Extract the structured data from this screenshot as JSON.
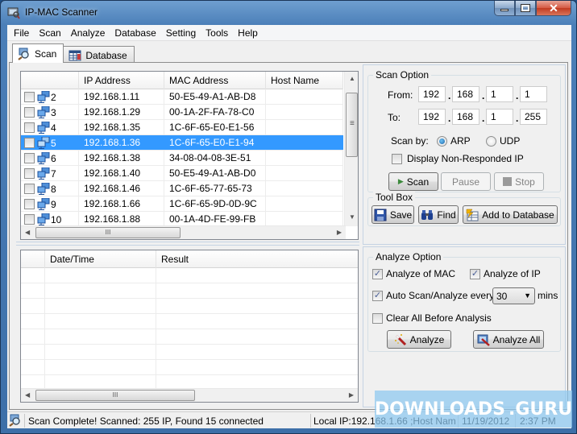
{
  "window": {
    "title": "IP-MAC Scanner",
    "buttons": {
      "minimize": "minimize",
      "maximize": "maximize",
      "close": "✕"
    }
  },
  "menu": [
    "File",
    "Scan",
    "Analyze",
    "Database",
    "Setting",
    "Tools",
    "Help"
  ],
  "tabs": [
    {
      "label": "Scan",
      "icon": "scan-icon",
      "active": true
    },
    {
      "label": "Database",
      "icon": "database-icon",
      "active": false
    }
  ],
  "scan_grid": {
    "columns": [
      "",
      "IP Address",
      "MAC Address",
      "Host Name"
    ],
    "rows": [
      {
        "num": "2",
        "ip": "192.168.1.11",
        "mac": "50-E5-49-A1-AB-D8",
        "host": "",
        "checked": false,
        "selected": false
      },
      {
        "num": "3",
        "ip": "192.168.1.29",
        "mac": "00-1A-2F-FA-78-C0",
        "host": "",
        "checked": false,
        "selected": false
      },
      {
        "num": "4",
        "ip": "192.168.1.35",
        "mac": "1C-6F-65-E0-E1-56",
        "host": "",
        "checked": false,
        "selected": false
      },
      {
        "num": "5",
        "ip": "192.168.1.36",
        "mac": "1C-6F-65-E0-E1-94",
        "host": "",
        "checked": false,
        "selected": true
      },
      {
        "num": "6",
        "ip": "192.168.1.38",
        "mac": "34-08-04-08-3E-51",
        "host": "",
        "checked": false,
        "selected": false
      },
      {
        "num": "7",
        "ip": "192.168.1.40",
        "mac": "50-E5-49-A1-AB-D0",
        "host": "",
        "checked": false,
        "selected": false
      },
      {
        "num": "8",
        "ip": "192.168.1.46",
        "mac": "1C-6F-65-77-65-73",
        "host": "",
        "checked": false,
        "selected": false
      },
      {
        "num": "9",
        "ip": "192.168.1.66",
        "mac": "1C-6F-65-9D-0D-9C",
        "host": "",
        "checked": false,
        "selected": false
      },
      {
        "num": "10",
        "ip": "192.168.1.88",
        "mac": "00-1A-4D-FE-99-FB",
        "host": "",
        "checked": false,
        "selected": false
      }
    ]
  },
  "result_grid": {
    "columns": [
      "",
      "Date/Time",
      "Result"
    ],
    "rows": []
  },
  "scan_option": {
    "title": "Scan Option",
    "from_label": "From:",
    "to_label": "To:",
    "from": [
      "192",
      "168",
      "1",
      "1"
    ],
    "to": [
      "192",
      "168",
      "1",
      "255"
    ],
    "scan_by_label": "Scan by:",
    "arp_label": "ARP",
    "udp_label": "UDP",
    "scan_by_selected": "ARP",
    "non_responded_label": "Display Non-Responded IP",
    "non_responded_checked": false,
    "scan_button": "Scan",
    "pause_button": "Pause",
    "stop_button": "Stop"
  },
  "tool_box": {
    "title": "Tool Box",
    "save_button": "Save",
    "find_button": "Find",
    "add_db_button": "Add to Database"
  },
  "analyze_option": {
    "title": "Analyze Option",
    "mac_label": "Analyze of MAC",
    "mac_checked": true,
    "ip_label": "Analyze of IP",
    "ip_checked": true,
    "auto_label": "Auto Scan/Analyze every",
    "auto_checked": true,
    "interval": "30",
    "interval_unit": "mins",
    "clear_label": "Clear All Before Analysis",
    "clear_checked": false,
    "analyze_button": "Analyze",
    "analyze_all_button": "Analyze All"
  },
  "status": {
    "message": "Scan Complete! Scanned: 255 IP, Found 15 connected",
    "local": "Local IP:192.168.1.66 ;Host Nam",
    "date": "11/19/2012",
    "time": "2:37 PM"
  },
  "watermark": {
    "left": "DOWNLOADS",
    "right": ".GURU"
  },
  "colors": {
    "selection": "#3399ff",
    "frame": "#4b7fb8",
    "close": "#c23b21"
  }
}
